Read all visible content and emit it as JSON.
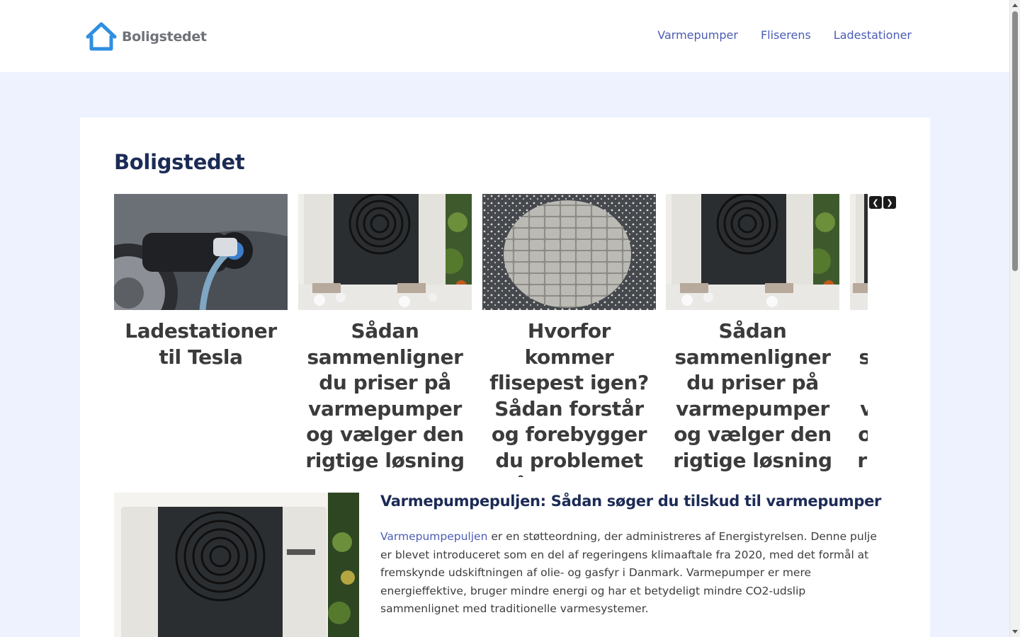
{
  "header": {
    "logo_text": "Boligstedet",
    "nav": [
      {
        "label": "Varmepumper"
      },
      {
        "label": "Fliserens"
      },
      {
        "label": "Ladestationer"
      }
    ]
  },
  "main": {
    "title": "Boligstedet",
    "carousel": {
      "slides": [
        {
          "title": "Ladestationer til Tesla",
          "image": "ev-charging-photo"
        },
        {
          "title": "Sådan sammenligner du priser på varmepumper og vælger den rigtige løsning",
          "image": "heat-pump-photo"
        },
        {
          "title": "Hvorfor kommer flisepest igen? Sådan forstår og forebygger du problemet på terrassen",
          "image": "patio-tiles-photo"
        },
        {
          "title": "Sådan sammenligner du priser på varmepumper og vælger den rigtige løsning",
          "image": "heat-pump-photo"
        },
        {
          "title": "Sådan sammenligner du priser på varmepumper og vælger den rigtige løsning",
          "image": "heat-pump-photo"
        }
      ],
      "prev_icon": "chevron-left-icon",
      "next_icon": "chevron-right-icon"
    },
    "feature": {
      "title": "Varmepumpepuljen: Sådan søger du tilskud til varmepumper",
      "link_text": "Varmepumpepuljen",
      "body": " er en støtteordning, der administreres af Energistyrelsen. Denne pulje er blevet introduceret som en del af regeringens klimaaftale fra 2020, med det formål at fremskynde udskiftningen af olie- og gasfyr i Danmark. Varmepumper er mere energieffektive, bruger mindre energi og har et betydeligt mindre CO2-udslip sammenlignet med traditionelle varmesystemer."
    }
  },
  "colors": {
    "page_background": "#edf2fe",
    "brand_blue": "#2f8fe0",
    "link": "#4b5cb6",
    "heading": "#1c2b56"
  }
}
